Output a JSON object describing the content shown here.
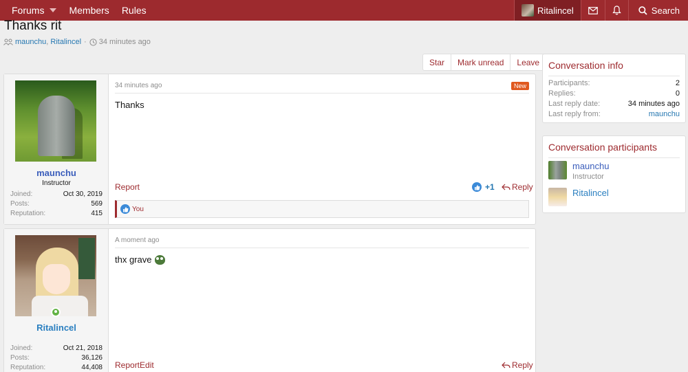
{
  "nav": {
    "forums": "Forums",
    "members": "Members",
    "rules": "Rules",
    "username": "Ritalincel",
    "search": "Search"
  },
  "header": {
    "title": "Thanks rit",
    "participant_1": "maunchu",
    "participant_sep": ",",
    "participant_2": "Ritalincel",
    "time": "34 minutes ago"
  },
  "actions": {
    "star": "Star",
    "mark_unread": "Mark unread",
    "leave": "Leave"
  },
  "messages": [
    {
      "author": "maunchu",
      "user_title": "Instructor",
      "stats": [
        {
          "label": "Joined:",
          "value": "Oct 30, 2019"
        },
        {
          "label": "Posts:",
          "value": "569"
        },
        {
          "label": "Reputation:",
          "value": "415"
        }
      ],
      "date": "34 minutes ago",
      "badge": "New",
      "body": "Thanks",
      "report": "Report",
      "like_count": "+1",
      "reply": "Reply",
      "liked_by": "You"
    },
    {
      "author": "Ritalincel",
      "user_title": "",
      "stats": [
        {
          "label": "Joined:",
          "value": "Oct 21, 2018"
        },
        {
          "label": "Posts:",
          "value": "36,126"
        },
        {
          "label": "Reputation:",
          "value": "44,408"
        }
      ],
      "date": "A moment ago",
      "body": "thx grave",
      "report": "Report",
      "edit": "Edit",
      "reply": "Reply"
    }
  ],
  "sidebar": {
    "info_title": "Conversation info",
    "info": [
      {
        "label": "Participants:",
        "value": "2"
      },
      {
        "label": "Replies:",
        "value": "0"
      },
      {
        "label": "Last reply date:",
        "value": "34 minutes ago"
      },
      {
        "label": "Last reply from:",
        "value": "maunchu"
      }
    ],
    "participants_title": "Conversation participants",
    "participants": [
      {
        "name": "maunchu",
        "title": "Instructor"
      },
      {
        "name": "Ritalincel",
        "title": ""
      }
    ]
  }
}
